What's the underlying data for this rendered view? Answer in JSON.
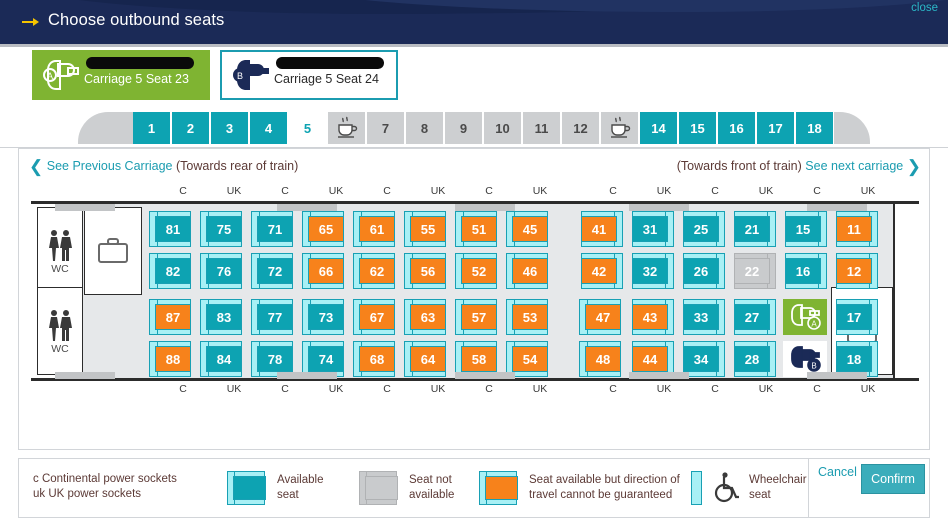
{
  "header": {
    "title": "Choose outbound seats",
    "close_label": "close",
    "arrow_icon": "arrow-right-icon",
    "bg_color": "#1b2a57",
    "accent_color": "#0da3b2"
  },
  "passengers": [
    {
      "badge": "A",
      "seat_label": "Carriage 5 Seat 23",
      "selected": true,
      "name_redacted": true,
      "color": "#7fb432"
    },
    {
      "badge": "B",
      "seat_label": "Carriage 5 Seat 24",
      "selected": false,
      "name_redacted": true,
      "color": "#1b9cb0"
    }
  ],
  "carriage_tabs": [
    {
      "label": "1",
      "state": "teal"
    },
    {
      "label": "2",
      "state": "teal"
    },
    {
      "label": "3",
      "state": "teal"
    },
    {
      "label": "4",
      "state": "teal"
    },
    {
      "label": "5",
      "state": "active"
    },
    {
      "label": "",
      "state": "grey",
      "icon": "coffee-cup-icon"
    },
    {
      "label": "7",
      "state": "grey"
    },
    {
      "label": "8",
      "state": "grey"
    },
    {
      "label": "9",
      "state": "grey"
    },
    {
      "label": "10",
      "state": "grey"
    },
    {
      "label": "11",
      "state": "grey"
    },
    {
      "label": "12",
      "state": "grey"
    },
    {
      "label": "",
      "state": "grey",
      "icon": "coffee-cup-icon"
    },
    {
      "label": "14",
      "state": "teal"
    },
    {
      "label": "15",
      "state": "teal"
    },
    {
      "label": "16",
      "state": "teal"
    },
    {
      "label": "17",
      "state": "teal"
    },
    {
      "label": "18",
      "state": "teal"
    }
  ],
  "navigation": {
    "prev_link": "See Previous Carriage",
    "prev_note": "(Towards rear of train)",
    "next_note": "(Towards front of train)",
    "next_link": "See next carriage",
    "prev_icon": "chevron-left-icon",
    "next_icon": "chevron-right-icon"
  },
  "socket_labels_top": [
    "C",
    "UK",
    "C",
    "UK",
    "C",
    "UK",
    "C",
    "UK",
    "C",
    "UK",
    "C",
    "UK",
    "C",
    "UK"
  ],
  "socket_labels_bottom": [
    "C",
    "UK",
    "C",
    "UK",
    "C",
    "UK",
    "C",
    "UK",
    "C",
    "UK",
    "C",
    "UK",
    "C",
    "UK"
  ],
  "facilities": {
    "wc_label": "WC",
    "wc_icon": "toilet-people-icon",
    "luggage_icon": "suitcase-icon"
  },
  "seats_top": [
    {
      "number": "81",
      "state": "avail",
      "orient": "l"
    },
    {
      "number": "82",
      "state": "avail",
      "orient": "l"
    },
    {
      "number": "75",
      "state": "avail",
      "orient": "l"
    },
    {
      "number": "76",
      "state": "avail",
      "orient": "l"
    },
    {
      "number": "71",
      "state": "avail",
      "orient": "l"
    },
    {
      "number": "72",
      "state": "avail",
      "orient": "l"
    },
    {
      "number": "65",
      "state": "orange",
      "orient": "l"
    },
    {
      "number": "66",
      "state": "orange",
      "orient": "l"
    },
    {
      "number": "61",
      "state": "orange",
      "orient": "l"
    },
    {
      "number": "62",
      "state": "orange",
      "orient": "l"
    },
    {
      "number": "55",
      "state": "orange",
      "orient": "l"
    },
    {
      "number": "56",
      "state": "orange",
      "orient": "l"
    },
    {
      "number": "51",
      "state": "orange",
      "orient": "l"
    },
    {
      "number": "52",
      "state": "orange",
      "orient": "l"
    },
    {
      "number": "45",
      "state": "orange",
      "orient": "l"
    },
    {
      "number": "46",
      "state": "orange",
      "orient": "l"
    },
    {
      "number": "41",
      "state": "orange",
      "orient": "r"
    },
    {
      "number": "42",
      "state": "orange",
      "orient": "r"
    },
    {
      "number": "31",
      "state": "avail",
      "orient": "r"
    },
    {
      "number": "32",
      "state": "avail",
      "orient": "r"
    },
    {
      "number": "25",
      "state": "avail",
      "orient": "r"
    },
    {
      "number": "26",
      "state": "avail",
      "orient": "r"
    },
    {
      "number": "21",
      "state": "avail",
      "orient": "r"
    },
    {
      "number": "22",
      "state": "na",
      "orient": "r"
    },
    {
      "number": "15",
      "state": "avail",
      "orient": "r"
    },
    {
      "number": "16",
      "state": "avail",
      "orient": "r"
    },
    {
      "number": "11",
      "state": "orange",
      "orient": "r"
    },
    {
      "number": "12",
      "state": "orange",
      "orient": "r"
    }
  ],
  "seats_bottom": [
    {
      "number": "87",
      "state": "orange",
      "orient": "l"
    },
    {
      "number": "88",
      "state": "orange",
      "orient": "l"
    },
    {
      "number": "83",
      "state": "avail",
      "orient": "l"
    },
    {
      "number": "84",
      "state": "avail",
      "orient": "l"
    },
    {
      "number": "77",
      "state": "avail",
      "orient": "l"
    },
    {
      "number": "78",
      "state": "avail",
      "orient": "l"
    },
    {
      "number": "73",
      "state": "avail",
      "orient": "l"
    },
    {
      "number": "74",
      "state": "avail",
      "orient": "l"
    },
    {
      "number": "67",
      "state": "orange",
      "orient": "l"
    },
    {
      "number": "68",
      "state": "orange",
      "orient": "l"
    },
    {
      "number": "63",
      "state": "orange",
      "orient": "l"
    },
    {
      "number": "64",
      "state": "orange",
      "orient": "l"
    },
    {
      "number": "57",
      "state": "orange",
      "orient": "l"
    },
    {
      "number": "58",
      "state": "orange",
      "orient": "l"
    },
    {
      "number": "53",
      "state": "orange",
      "orient": "l"
    },
    {
      "number": "54",
      "state": "orange",
      "orient": "l"
    },
    {
      "number": "47",
      "state": "orange",
      "orient": "l"
    },
    {
      "number": "48",
      "state": "orange",
      "orient": "l"
    },
    {
      "number": "43",
      "state": "orange",
      "orient": "r"
    },
    {
      "number": "44",
      "state": "orange",
      "orient": "r"
    },
    {
      "number": "33",
      "state": "avail",
      "orient": "r"
    },
    {
      "number": "34",
      "state": "avail",
      "orient": "r"
    },
    {
      "number": "27",
      "state": "avail",
      "orient": "r"
    },
    {
      "number": "28",
      "state": "avail",
      "orient": "r"
    },
    {
      "number": "23",
      "state": "paxA",
      "orient": "r"
    },
    {
      "number": "24",
      "state": "paxB",
      "orient": "r"
    },
    {
      "number": "17",
      "state": "avail",
      "orient": "r"
    },
    {
      "number": "18",
      "state": "avail",
      "orient": "r"
    }
  ],
  "legend": {
    "power_continental": "c Continental power sockets",
    "power_uk": "uk UK power sockets",
    "available_seat": "Available\nseat",
    "available_seat_l1": "Available",
    "available_seat_l2": "seat",
    "not_available_l1": "Seat not",
    "not_available_l2": "available",
    "direction_l1": "Seat available but direction of",
    "direction_l2": "travel cannot be guaranteed",
    "wheelchair_l1": "Wheelchair",
    "wheelchair_l2": "seat",
    "wheelchair_icon": "wheelchair-icon"
  },
  "actions": {
    "cancel_label": "Cancel",
    "confirm_label": "Confirm"
  },
  "colors": {
    "teal": "#0da3b2",
    "orange": "#f7821b",
    "grey": "#c9cbcd",
    "green": "#7fb432",
    "navy": "#1b2a57",
    "seat_outline": "#18a0b4",
    "seat_light": "#a8f0f5"
  }
}
